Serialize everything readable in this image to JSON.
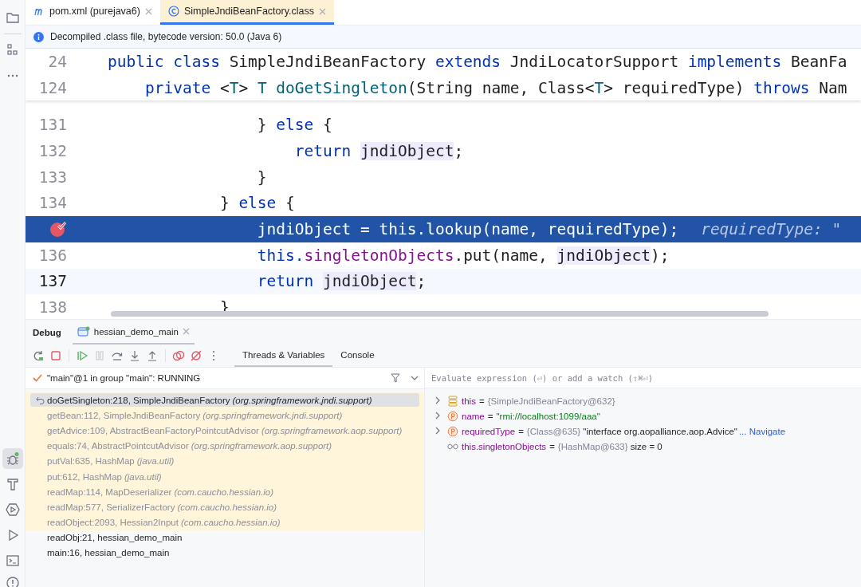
{
  "editor_tabs": [
    {
      "label": "pom.xml (purejava6)",
      "kind": "maven",
      "selected": false
    },
    {
      "label": "SimpleJndiBeanFactory.class",
      "kind": "class",
      "selected": true
    }
  ],
  "info_banner": "Decompiled .class file, bytecode version: 50.0 (Java 6)",
  "sticky_lines": [
    {
      "number": "24",
      "tokens": [
        {
          "text": "public class ",
          "kind": "keyword"
        },
        {
          "text": "SimpleJndiBeanFactory ",
          "kind": "plain"
        },
        {
          "text": "extends ",
          "kind": "keyword"
        },
        {
          "text": "JndiLocatorSupport ",
          "kind": "plain"
        },
        {
          "text": "implements ",
          "kind": "keyword"
        },
        {
          "text": "BeanFa",
          "kind": "plain"
        }
      ]
    },
    {
      "number": "124",
      "tokens": [
        {
          "text": "    private ",
          "kind": "keyword"
        },
        {
          "text": "<",
          "kind": "plain"
        },
        {
          "text": "T",
          "kind": "type"
        },
        {
          "text": "> ",
          "kind": "plain"
        },
        {
          "text": "T ",
          "kind": "type"
        },
        {
          "text": "doGetSingleton",
          "kind": "method"
        },
        {
          "text": "(String name, Class<",
          "kind": "plain"
        },
        {
          "text": "T",
          "kind": "type"
        },
        {
          "text": "> requiredType) ",
          "kind": "plain"
        },
        {
          "text": "throws ",
          "kind": "keyword"
        },
        {
          "text": "Nam",
          "kind": "plain"
        }
      ]
    }
  ],
  "code_lines": [
    {
      "number": "131",
      "breakpoint": false,
      "selected": false,
      "current": false,
      "tokens": [
        {
          "text": "                } ",
          "kind": "plain"
        },
        {
          "text": "else ",
          "kind": "keyword"
        },
        {
          "text": "{",
          "kind": "plain"
        }
      ]
    },
    {
      "number": "132",
      "breakpoint": false,
      "selected": false,
      "current": false,
      "tokens": [
        {
          "text": "                    return ",
          "kind": "keyword"
        },
        {
          "text": "jndiObject",
          "kind": "highlight"
        },
        {
          "text": ";",
          "kind": "plain"
        }
      ]
    },
    {
      "number": "133",
      "breakpoint": false,
      "selected": false,
      "current": false,
      "tokens": [
        {
          "text": "                }",
          "kind": "plain"
        }
      ]
    },
    {
      "number": "134",
      "breakpoint": false,
      "selected": false,
      "current": false,
      "tokens": [
        {
          "text": "            } ",
          "kind": "plain"
        },
        {
          "text": "else ",
          "kind": "keyword"
        },
        {
          "text": "{",
          "kind": "plain"
        }
      ]
    },
    {
      "breakpoint": true,
      "selected": true,
      "current": false,
      "tokens": [
        {
          "text": "                jndiObject = this.lookup(name, requiredType);",
          "kind": "plain"
        }
      ],
      "hint": "requiredType: \""
    },
    {
      "number": "136",
      "breakpoint": false,
      "selected": false,
      "current": false,
      "tokens": [
        {
          "text": "                this.",
          "kind": "keyword"
        },
        {
          "text": "singletonObjects",
          "kind": "field"
        },
        {
          "text": ".put(name, ",
          "kind": "plain"
        },
        {
          "text": "jndiObject",
          "kind": "highlight"
        },
        {
          "text": ");",
          "kind": "plain"
        }
      ]
    },
    {
      "number": "137",
      "breakpoint": false,
      "selected": false,
      "current": true,
      "tokens": [
        {
          "text": "                return ",
          "kind": "keyword"
        },
        {
          "text": "jndiObject",
          "kind": "highlight"
        },
        {
          "text": ";",
          "kind": "plain"
        }
      ]
    },
    {
      "number": "138",
      "breakpoint": false,
      "selected": false,
      "current": false,
      "tokens": [
        {
          "text": "            }",
          "kind": "plain"
        }
      ]
    }
  ],
  "debug": {
    "title": "Debug",
    "session_tab": "hessian_demo_main",
    "view_tabs": [
      {
        "label": "Threads & Variables",
        "selected": true
      },
      {
        "label": "Console",
        "selected": false
      }
    ],
    "thread": "\"main\"@1 in group \"main\": RUNNING",
    "frames": [
      {
        "method": "doGetSingleton:218, SimpleJndiBeanFactory",
        "package": "(org.springframework.jndi.support)",
        "kind": "library",
        "selected": true
      },
      {
        "method": "getBean:112, SimpleJndiBeanFactory",
        "package": "(org.springframework.jndi.support)",
        "kind": "library",
        "selected": false
      },
      {
        "method": "getAdvice:109, AbstractBeanFactoryPointcutAdvisor",
        "package": "(org.springframework.aop.support)",
        "kind": "library",
        "selected": false
      },
      {
        "method": "equals:74, AbstractPointcutAdvisor",
        "package": "(org.springframework.aop.support)",
        "kind": "library",
        "selected": false
      },
      {
        "method": "putVal:635, HashMap",
        "package": "(java.util)",
        "kind": "library",
        "selected": false
      },
      {
        "method": "put:612, HashMap",
        "package": "(java.util)",
        "kind": "library",
        "selected": false
      },
      {
        "method": "readMap:114, MapDeserializer",
        "package": "(com.caucho.hessian.io)",
        "kind": "library",
        "selected": false
      },
      {
        "method": "readMap:577, SerializerFactory",
        "package": "(com.caucho.hessian.io)",
        "kind": "library",
        "selected": false
      },
      {
        "method": "readObject:2093, Hessian2Input",
        "package": "(com.caucho.hessian.io)",
        "kind": "library",
        "selected": false
      },
      {
        "method": "readObj:21, hessian_demo_main",
        "kind": "user",
        "selected": false
      },
      {
        "method": "main:16, hessian_demo_main",
        "kind": "user",
        "selected": false
      }
    ],
    "evaluate_placeholder": "Evaluate expression (⏎) or add a watch (⇧⌘⏎)",
    "variables": [
      {
        "kind": "object",
        "expandable": true,
        "name": "this",
        "operator": "=",
        "ref": "{SimpleJndiBeanFactory@632}"
      },
      {
        "kind": "param",
        "expandable": true,
        "name": "name",
        "operator": "=",
        "string_value": "\"rmi://localhost:1099/aaa\""
      },
      {
        "kind": "param",
        "expandable": true,
        "name": "requiredType",
        "operator": "=",
        "ref": "{Class@635}",
        "text_value": "\"interface org.aopalliance.aop.Advice\"",
        "link": "... Navigate"
      },
      {
        "kind": "watch",
        "expandable": false,
        "name": "this.singletonObjects",
        "operator": "=",
        "ref": "{HashMap@633}",
        "text_value": "size = 0"
      }
    ]
  }
}
